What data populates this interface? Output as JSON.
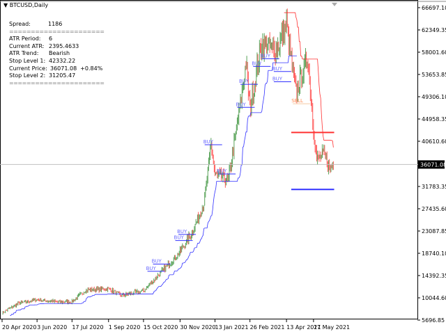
{
  "window": {
    "title": "BTCUSD,Daily"
  },
  "info": {
    "spread_label": "Spread:",
    "spread": "1186",
    "separator": "======================",
    "atr_period_label": "ATR Period:",
    "atr_period": "6",
    "current_atr_label": "Current ATR:",
    "current_atr": "2395.4633",
    "atr_trend_label": "ATR Trend:",
    "atr_trend": "Bearish",
    "stop1_label": "Stop Level 1:",
    "stop1": "42332.22",
    "current_price_label": "Current Price:",
    "current_price": "36071.08",
    "change": "+0.84%",
    "stop2_label": "Stop Level 2:",
    "stop2": "31205.47"
  },
  "colors": {
    "bull": "#2e8b2e",
    "bear": "#ff3030",
    "buy": "#3030ff",
    "sell": "#ff3030",
    "price_line": "#c0c0c0"
  },
  "chart_data": {
    "type": "candlestick",
    "symbol": "BTCUSD",
    "timeframe": "Daily",
    "ylim": [
      5696.85,
      66697.1
    ],
    "y_ticks": [
      "66697.10",
      "62349.35",
      "58001.60",
      "53653.85",
      "49306.10",
      "44958.35",
      "40610.60",
      "31783.35",
      "27435.60",
      "23087.85",
      "18740.10",
      "14392.35",
      "10044.60",
      "5696.85"
    ],
    "current_price_label": "36071.08",
    "current_price": 36071.08,
    "stop_level_1": 42332.22,
    "stop_level_2": 31205.47,
    "x_ticks": [
      {
        "label": "20 Apr 2020",
        "day": 0
      },
      {
        "label": "3 Jun 2020",
        "day": 44
      },
      {
        "label": "17 Jul 2020",
        "day": 88
      },
      {
        "label": "1 Sep 2020",
        "day": 134
      },
      {
        "label": "15 Oct 2020",
        "day": 178
      },
      {
        "label": "30 Nov 2020",
        "day": 224
      },
      {
        "label": "13 Jan 2021",
        "day": 268
      },
      {
        "label": "26 Feb 2021",
        "day": 312
      },
      {
        "label": "13 Apr 2021",
        "day": 358
      },
      {
        "label": "17 May 2021",
        "day": 392
      }
    ],
    "price_path": [
      [
        0,
        7100
      ],
      [
        20,
        8900
      ],
      [
        44,
        9700
      ],
      [
        70,
        9200
      ],
      [
        88,
        9300
      ],
      [
        105,
        11500
      ],
      [
        120,
        11700
      ],
      [
        134,
        11800
      ],
      [
        150,
        10500
      ],
      [
        178,
        11400
      ],
      [
        200,
        15000
      ],
      [
        224,
        19000
      ],
      [
        240,
        23000
      ],
      [
        255,
        29000
      ],
      [
        263,
        40000
      ],
      [
        268,
        34000
      ],
      [
        285,
        33000
      ],
      [
        300,
        48000
      ],
      [
        307,
        56000
      ],
      [
        312,
        47000
      ],
      [
        327,
        60000
      ],
      [
        345,
        58000
      ],
      [
        358,
        63500
      ],
      [
        370,
        50000
      ],
      [
        385,
        57000
      ],
      [
        392,
        43000
      ],
      [
        396,
        37000
      ],
      [
        405,
        38000
      ],
      [
        412,
        35500
      ],
      [
        417,
        36071
      ]
    ],
    "signals": [
      {
        "text": "BUY",
        "day": 255,
        "price": 40200,
        "type": "buy"
      },
      {
        "text": "BUY",
        "day": 272,
        "price": 34500,
        "type": "buy"
      },
      {
        "text": "BUY",
        "day": 296,
        "price": 47500,
        "type": "buy"
      },
      {
        "text": "BUY",
        "day": 300,
        "price": 52000,
        "type": "buy"
      },
      {
        "text": "BUY",
        "day": 316,
        "price": 55500,
        "type": "buy"
      },
      {
        "text": "BUY",
        "day": 327,
        "price": 57000,
        "type": "buy"
      },
      {
        "text": "BUY",
        "day": 342,
        "price": 54500,
        "type": "buy"
      },
      {
        "text": "BUY",
        "day": 342,
        "price": 52500,
        "type": "buy"
      },
      {
        "text": "SELL",
        "day": 366,
        "price": 48200,
        "type": "sell"
      },
      {
        "text": "BUY",
        "day": 222,
        "price": 22700,
        "type": "buy"
      },
      {
        "text": "BUY",
        "day": 218,
        "price": 21500,
        "type": "buy"
      },
      {
        "text": "BUY",
        "day": 190,
        "price": 16900,
        "type": "buy"
      },
      {
        "text": "BUY",
        "day": 183,
        "price": 15500,
        "type": "buy"
      }
    ]
  }
}
